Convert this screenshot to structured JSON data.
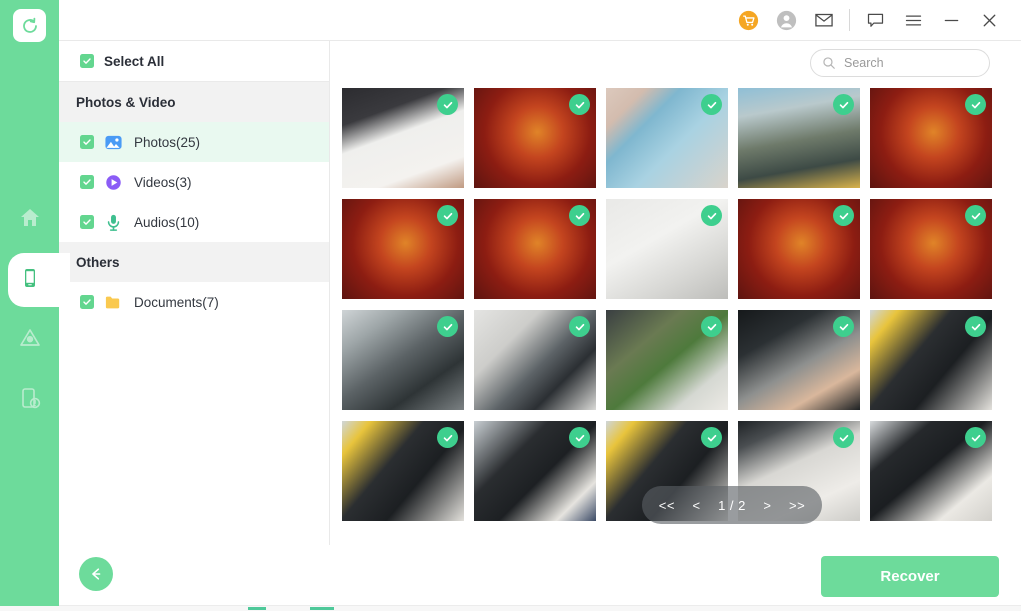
{
  "app": {
    "logo_icon": "recovery-refresh-icon",
    "accent_green": "#6ddb9b",
    "check_green": "#3ecf8e",
    "cart_orange": "#f5a623"
  },
  "rail": {
    "items": [
      {
        "name": "home",
        "icon": "home-icon",
        "active": false
      },
      {
        "name": "device",
        "icon": "phone-icon",
        "active": true
      },
      {
        "name": "cloud",
        "icon": "cloud-icon",
        "active": false
      },
      {
        "name": "repair",
        "icon": "device-warning-icon",
        "active": false
      }
    ]
  },
  "titlebar": {
    "buttons": [
      {
        "name": "cart",
        "icon": "shopping-cart-icon"
      },
      {
        "name": "account",
        "icon": "user-account-icon"
      },
      {
        "name": "mail",
        "icon": "mail-envelope-icon"
      },
      {
        "name": "feedback",
        "icon": "chat-bubble-icon"
      },
      {
        "name": "menu",
        "icon": "hamburger-menu-icon"
      },
      {
        "name": "minimize",
        "icon": "minimize-icon"
      },
      {
        "name": "close",
        "icon": "close-x-icon"
      }
    ]
  },
  "sidebar": {
    "select_all": {
      "label": "Select All",
      "checked": true
    },
    "sections": [
      {
        "title": "Photos & Video",
        "items": [
          {
            "label": "Photos(25)",
            "icon": "photo-icon",
            "checked": true,
            "active": true
          },
          {
            "label": "Videos(3)",
            "icon": "video-play-icon",
            "checked": true,
            "active": false
          },
          {
            "label": "Audios(10)",
            "icon": "microphone-icon",
            "checked": true,
            "active": false
          }
        ]
      },
      {
        "title": "Others",
        "items": [
          {
            "label": "Documents(7)",
            "icon": "folder-icon",
            "checked": true,
            "active": false
          }
        ]
      }
    ]
  },
  "search": {
    "placeholder": "Search",
    "value": "",
    "icon": "search-icon"
  },
  "grid": {
    "columns": 5,
    "rows": 4,
    "all_selected": true,
    "thumbnails": [
      {
        "id": 1,
        "scene": "keyboard-on-white-desk",
        "selected": true
      },
      {
        "id": 2,
        "scene": "red-snack-package",
        "selected": true
      },
      {
        "id": 3,
        "scene": "blue-phone-back",
        "selected": true
      },
      {
        "id": 4,
        "scene": "outdoor-kiosk-sign",
        "selected": true
      },
      {
        "id": 5,
        "scene": "red-snack-package",
        "selected": true
      },
      {
        "id": 6,
        "scene": "red-snack-package",
        "selected": true
      },
      {
        "id": 7,
        "scene": "red-snack-package",
        "selected": true
      },
      {
        "id": 8,
        "scene": "white-wall-mark",
        "selected": true
      },
      {
        "id": 9,
        "scene": "red-snack-package",
        "selected": true
      },
      {
        "id": 10,
        "scene": "red-snack-package",
        "selected": true
      },
      {
        "id": 11,
        "scene": "office-interior-lights",
        "selected": true
      },
      {
        "id": 12,
        "scene": "office-monitor-desk",
        "selected": true
      },
      {
        "id": 13,
        "scene": "desk-plant-monitor",
        "selected": true
      },
      {
        "id": 14,
        "scene": "hand-on-keyboard-office",
        "selected": true
      },
      {
        "id": 15,
        "scene": "keyboard-yellow-object",
        "selected": true
      },
      {
        "id": 16,
        "scene": "keyboard-yellow-object",
        "selected": true
      },
      {
        "id": 17,
        "scene": "keyboard-desk-cable",
        "selected": true
      },
      {
        "id": 18,
        "scene": "keyboard-yellow-object",
        "selected": true
      },
      {
        "id": 19,
        "scene": "pen-on-white-desk",
        "selected": true
      },
      {
        "id": 20,
        "scene": "keyboard-pen-desk",
        "selected": true
      }
    ]
  },
  "pagination": {
    "first_label": "<<",
    "prev_label": "<",
    "current_label": "1 / 2",
    "next_label": ">",
    "last_label": ">>",
    "current_page": 1,
    "total_pages": 2
  },
  "footer": {
    "back_icon": "arrow-left-icon",
    "recover_label": "Recover"
  }
}
